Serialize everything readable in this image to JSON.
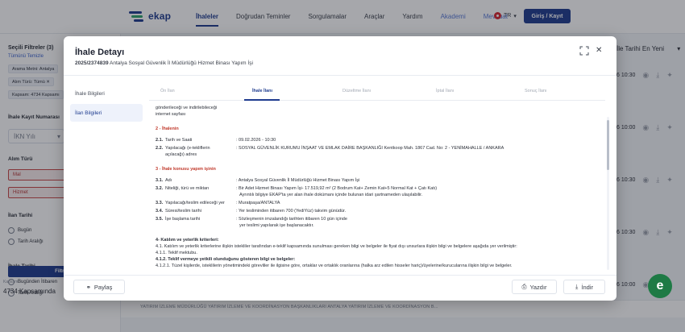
{
  "brand": {
    "name": "ekap",
    "color": "#1f3c8f"
  },
  "nav": {
    "items": [
      "İhaleler",
      "Doğrudan Teminler",
      "Sorgulamalar",
      "Araçlar",
      "Yardım",
      "Akademi",
      "Mevzuat"
    ],
    "active": "İhaleler",
    "lang": "TR",
    "login": "Giriş / Kayıt"
  },
  "sidebar": {
    "title": "Seçili Filtreler (3)",
    "clear": "Tümünü Temizle",
    "chips": [
      "Arama Metni: Antalya",
      "Alım Türü: Tümü ✕",
      "Kapsam: 4734 Kapsamı"
    ],
    "ihale_kayit_label": "İhale Kayıt Numarası",
    "ikn_placeholder": "İKN Yılı",
    "alim_turu_label": "Alım Türü",
    "alim_turu_options": [
      "Mal",
      "Hizmet"
    ],
    "ilan_tarihi_label": "İlan Tarihi",
    "ilan_tarihi_options": [
      "Bugün",
      "Tarih Aralığı"
    ],
    "ihale_tarihi_label": "İhale Tarihi",
    "ihale_tarihi_options": [
      "Bugünden İtibaren",
      "Tarih Aralığı"
    ],
    "filter_button": "Filtrele",
    "kapsam_label": "Kapsam",
    "kapsam_value": "4734 Kapsamında"
  },
  "list": {
    "sort": "İle Tarihi En Yeni",
    "times": [
      "6 10:30",
      "6 10:00",
      "6 10:30",
      "6 10:30",
      "6 10:00"
    ],
    "bottom_text": "YATIRIM İZLEME MÜDÜRLÜĞÜ YATIRIM İZLEME VE KOORDİNASYON BAŞKANLIKLARI ANTALYA YATIRIM İZLEME VE KOORDİNASYON B..."
  },
  "modal": {
    "title": "İhale Detayı",
    "ikn": "2025/2374839",
    "subject": "Antalya Sosyal Güvenlik İl Müdürlüğü Hizmet Binası Yapım İşi",
    "side_items": [
      "İhale Bilgileri",
      "İlan Bilgileri"
    ],
    "side_active": 1,
    "tabs": [
      "Ön İlan",
      "İhale İlanı",
      "Düzeltme İlanı",
      "İptal İlanı",
      "Sonuç İlanı"
    ],
    "tab_active": 1,
    "content": {
      "intro_lines": [
        "gönderileceği ve indirilebileceği",
        "internet sayfası"
      ],
      "section2_title": "2 - İhalenin",
      "s2_1_no": "2.1.",
      "s2_1_label": "Tarih ve Saati",
      "s2_1_value": ": 09.02.2026 - 10:30",
      "s2_2_no": "2.2.",
      "s2_2_label": "Yapılacağı (e-tekliflerin",
      "s2_2_label2": "açılacağı) adres",
      "s2_2_value": ": SOSYAL GÜVENLİK KURUMU İNŞAAT VE EMLAK DAİRE BAŞKANLIĞI Kentkoop Mah. 1867 Cad. No: 2 - YENİMAHALLE / ANKARA",
      "section3_title": "3 - İhale konusu yapım işinin",
      "s3_1_no": "3.1.",
      "s3_1_label": "Adı",
      "s3_1_value": ": Antalya Sosyal Güvenlik İl Müdürlüğü Hizmet Binası Yapım İşi",
      "s3_2_no": "3.2.",
      "s3_2_label": "Niteliği, türü ve miktarı",
      "s3_2_value": ": Bir Adet Hizmet Binası Yapım İşi- 17.519,92 m² (2 Bodrum Kat+ Zemin Kat+5 Normal Kat + Çatı Katı)",
      "s3_2_value2": "Ayrıntılı bilgiye EKAP'ta yer alan ihale dokümanı içinde bulunan idari şartnameden ulaşılabilir.",
      "s3_3_no": "3.3.",
      "s3_3_label": "Yapılacağı/teslim edileceği yer",
      "s3_3_value": ": Muratpaşa/ANTALYA",
      "s3_4_no": "3.4.",
      "s3_4_label": "Süresi/teslim tarihi",
      "s3_4_value": ": Yer tesliminden itibaren 700 (YediYüz) takvim günüdür.",
      "s3_5_no": "3.5.",
      "s3_5_label": "İşe başlama tarihi",
      "s3_5_value": ": Sözleşmenin imzalandığı tarihten itibaren 10 gün içinde",
      "s3_5_value2": "yer teslimi yapılarak işe başlanacaktır.",
      "section4_title": "4- Katılım ve yeterlik kriterleri:",
      "s4_1": "4.1. Katılım ve yeterlik kriterlerine ilişkin istekliler tarafından e-teklif kapsamında sunulması gereken bilgi ve belgeler ile fiyat dışı unsurlara ilişkin bilgi ve belgelere aşağıda yer verilmiştir:",
      "s4_1_1": "4.1.1. Teklif mektubu.",
      "s4_1_2": "4.1.2. Teklif vermeye yetkili olunduğunu gösteren bilgi ve belgeler:",
      "s4_1_2_1": "4.1.2.1. Tüzel kişilerde, isteklilerin yönetimindeki görevliler ile ilgisine göre, ortaklar ve ortaklık oranlarına (halka arz edilen hisseler hariç)/üyelerine/kurucularına ilişkin bilgi ve belgeler."
    },
    "share": "Paylaş",
    "print": "Yazdır",
    "download": "İndir"
  },
  "fab_letter": "e"
}
